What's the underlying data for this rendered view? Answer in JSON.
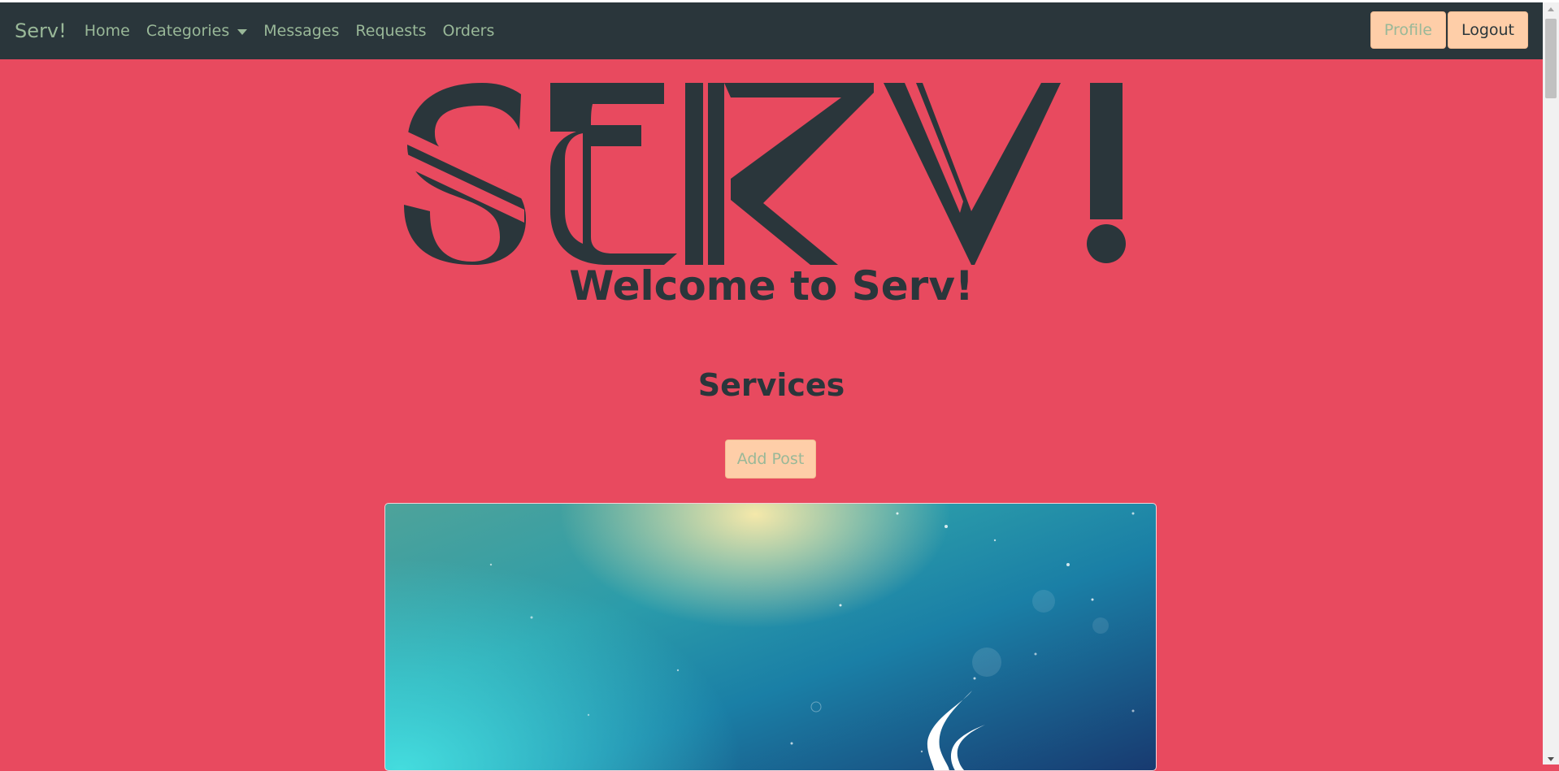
{
  "navbar": {
    "brand": "Serv!",
    "links": [
      {
        "label": "Home"
      },
      {
        "label": "Categories",
        "dropdown": true
      },
      {
        "label": "Messages"
      },
      {
        "label": "Requests"
      },
      {
        "label": "Orders"
      }
    ],
    "profile_label": "Profile",
    "logout_label": "Logout"
  },
  "hero": {
    "logo_text": "SERV!",
    "welcome": "Welcome to Serv!"
  },
  "services": {
    "heading": "Services",
    "add_post_label": "Add Post"
  },
  "card": {
    "image_icon": "java-logo-icon"
  },
  "colors": {
    "navbar_bg": "#2a363b",
    "page_bg": "#e84a5f",
    "nav_text": "#99b898",
    "button_bg": "#fecea8"
  }
}
